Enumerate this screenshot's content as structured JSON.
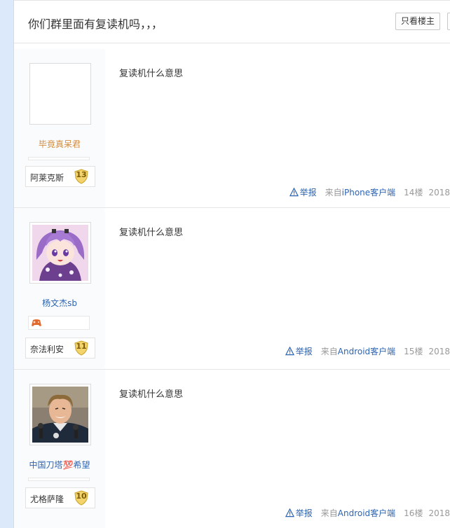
{
  "thread": {
    "title": "你们群里面有复读机吗，，，",
    "only_op_label": "只看楼主"
  },
  "posts": [
    {
      "author_name": "毕竟真呆君",
      "level_name": "阿莱克斯",
      "level_num": "13",
      "content": "复读机什么意思",
      "report_label": "举报",
      "source_prefix": "来自",
      "source_client": "iPhone客户端",
      "floor": "14楼",
      "date": "2018"
    },
    {
      "author_name": "杨文杰sb",
      "level_name": "奈法利安",
      "level_num": "11",
      "content": "复读机什么意思",
      "report_label": "举报",
      "source_prefix": "来自",
      "source_client": "Android客户端",
      "floor": "15楼",
      "date": "2018"
    },
    {
      "author_name": "中国刀塔💯希望",
      "level_name": "尤格萨隆",
      "level_num": "10",
      "content": "复读机什么意思",
      "report_label": "举报",
      "source_prefix": "来自",
      "source_client": "Android客户端",
      "floor": "16楼",
      "date": "2018"
    }
  ]
}
